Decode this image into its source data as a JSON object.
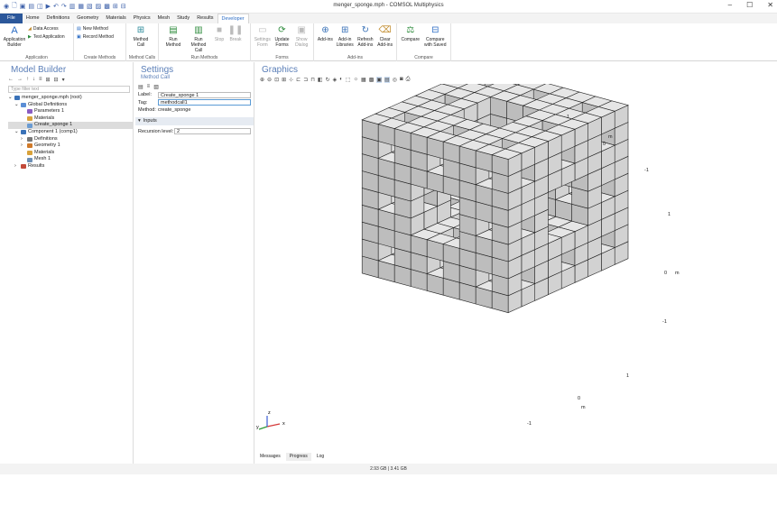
{
  "window": {
    "title": "menger_sponge.mph - COMSOL Multiphysics",
    "controls": [
      "–",
      "☐",
      "✕"
    ]
  },
  "tabs": [
    "File",
    "Home",
    "Definitions",
    "Geometry",
    "Materials",
    "Physics",
    "Mesh",
    "Study",
    "Results",
    "Developer"
  ],
  "active_tab": "Developer",
  "ribbon": {
    "application": {
      "label": "Application",
      "builder": "Application Builder",
      "data_access": "Data Access",
      "test_app": "Test Application"
    },
    "create_methods": {
      "label": "Create Methods",
      "new_method": "New Method",
      "record_method": "Record Method"
    },
    "method_calls": {
      "label": "Method Calls",
      "method_call": "Method Call"
    },
    "run_methods": {
      "label": "Run Methods",
      "run_method": "Run Method",
      "run_method_call": "Run Method Call",
      "stop": "Stop",
      "break": "Break"
    },
    "forms": {
      "label": "Forms",
      "settings_form": "Settings Form",
      "update_forms": "Update Forms",
      "show_dialog": "Show Dialog"
    },
    "addins": {
      "label": "Add-ins",
      "addins": "Add-ins",
      "addin_libraries": "Add-in Libraries",
      "refresh_addins": "Refresh Add-ins",
      "clear_addins": "Clear Add-ins"
    },
    "compare": {
      "label": "Compare",
      "compare": "Compare",
      "compare_saved": "Compare with Saved"
    }
  },
  "model_builder": {
    "title": "Model Builder",
    "filter_placeholder": "Type filter text",
    "tree": [
      {
        "label": "menger_sponge.mph (root)",
        "indent": 0,
        "color": "#3a72b8",
        "arrow": "⌄"
      },
      {
        "label": "Global Definitions",
        "indent": 1,
        "color": "#5b8ed6",
        "arrow": "⌄"
      },
      {
        "label": "Parameters 1",
        "indent": 2,
        "color": "#8a5cc2",
        "arrow": ""
      },
      {
        "label": "Materials",
        "indent": 2,
        "color": "#d9a23a",
        "arrow": ""
      },
      {
        "label": "Create_sponge 1",
        "indent": 2,
        "color": "#6a9bd2",
        "arrow": "",
        "selected": true
      },
      {
        "label": "Component 1 (comp1)",
        "indent": 1,
        "color": "#3a72b8",
        "arrow": "⌄"
      },
      {
        "label": "Definitions",
        "indent": 2,
        "color": "#777777",
        "arrow": "›"
      },
      {
        "label": "Geometry 1",
        "indent": 2,
        "color": "#d07a2a",
        "arrow": "›"
      },
      {
        "label": "Materials",
        "indent": 2,
        "color": "#d9a23a",
        "arrow": ""
      },
      {
        "label": "Mesh 1",
        "indent": 2,
        "color": "#6c8fb5",
        "arrow": ""
      },
      {
        "label": "Results",
        "indent": 1,
        "color": "#c24a3a",
        "arrow": "›"
      }
    ]
  },
  "settings": {
    "title": "Settings",
    "subtitle": "Method Call",
    "label_caption": "Label:",
    "label_value": "Create_sponge 1",
    "tag_caption": "Tag:",
    "tag_value": "methodcall1",
    "method_caption": "Method:",
    "method_value": "create_sponge",
    "inputs_section": "Inputs",
    "recursion_caption": "Recursion level:",
    "recursion_value": "2"
  },
  "graphics": {
    "title": "Graphics",
    "axis_labels": {
      "x_top": "1",
      "m_top": "m",
      "zero_top": "0",
      "neg_top": "-1",
      "y_pos": "1",
      "y_zero": "0",
      "y_m": "m",
      "y_neg": "-1",
      "z_pos": "1",
      "z_zero": "0",
      "z_m": "m",
      "z_neg": "-1"
    },
    "triad": {
      "x": "x",
      "y": "y",
      "z": "z"
    }
  },
  "bottom_tabs": [
    "Messages",
    "Progress",
    "Log"
  ],
  "status": "2.93 GB | 3.41 GB"
}
